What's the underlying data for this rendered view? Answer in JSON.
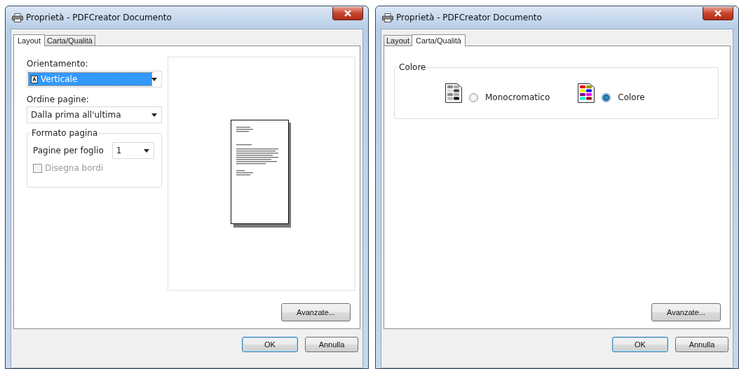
{
  "dialogs": [
    {
      "title": "Proprietà - PDFCreator Documento",
      "kind": "layout",
      "tabs": [
        {
          "label": "Layout",
          "selected": true
        },
        {
          "label": "Carta/Qualità",
          "selected": false
        }
      ],
      "layout": {
        "orientation": {
          "label": "Orientamento:",
          "value": "Verticale",
          "highlighted": true
        },
        "page_order": {
          "label": "Ordine pagine:",
          "value": "Dalla prima all'ultima"
        },
        "page_format": {
          "title": "Formato pagina",
          "pages_per_sheet": {
            "label": "Pagine per foglio",
            "value": "1"
          },
          "draw_borders": {
            "label": "Disegna bordi",
            "checked": false,
            "disabled": true
          }
        }
      },
      "advanced_button": "Avanzate...",
      "buttons": [
        "OK",
        "Annulla"
      ]
    },
    {
      "title": "Proprietà - PDFCreator Documento",
      "kind": "quality",
      "tabs": [
        {
          "label": "Layout",
          "selected": false
        },
        {
          "label": "Carta/Qualità",
          "selected": true
        }
      ],
      "quality": {
        "title": "Colore",
        "options": [
          {
            "label": "Monocromatico",
            "kind": "mono",
            "selected": false
          },
          {
            "label": "Colore",
            "kind": "color",
            "selected": true
          }
        ]
      },
      "advanced_button": "Avanzate...",
      "buttons": [
        "OK",
        "Annulla"
      ]
    }
  ]
}
